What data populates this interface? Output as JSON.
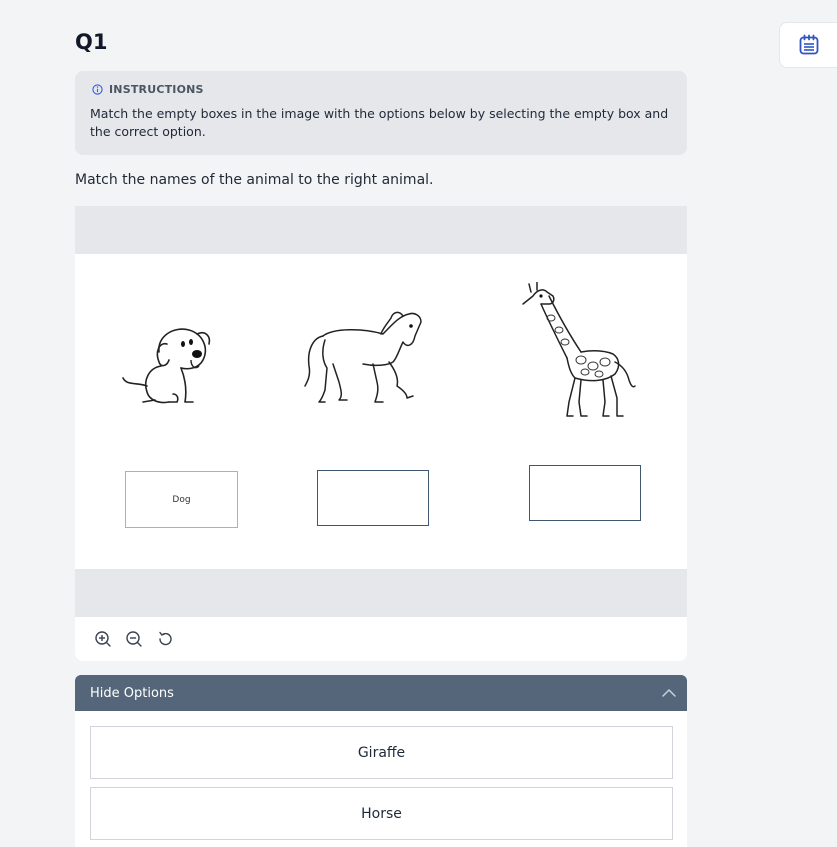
{
  "question": {
    "title": "Q1",
    "prompt": "Match the names of the animal to the right animal."
  },
  "instructions": {
    "heading": "INSTRUCTIONS",
    "text": "Match the empty boxes in the image with the options below by selecting the empty box and the correct option."
  },
  "drop_boxes": [
    {
      "value": "Dog"
    },
    {
      "value": ""
    },
    {
      "value": ""
    }
  ],
  "options": {
    "toggle_label": "Hide Options",
    "items": [
      "Giraffe",
      "Horse"
    ]
  },
  "colors": {
    "accent": "#3b5bdb",
    "options_header": "#55657a",
    "panel_gray": "#e5e7eb"
  }
}
